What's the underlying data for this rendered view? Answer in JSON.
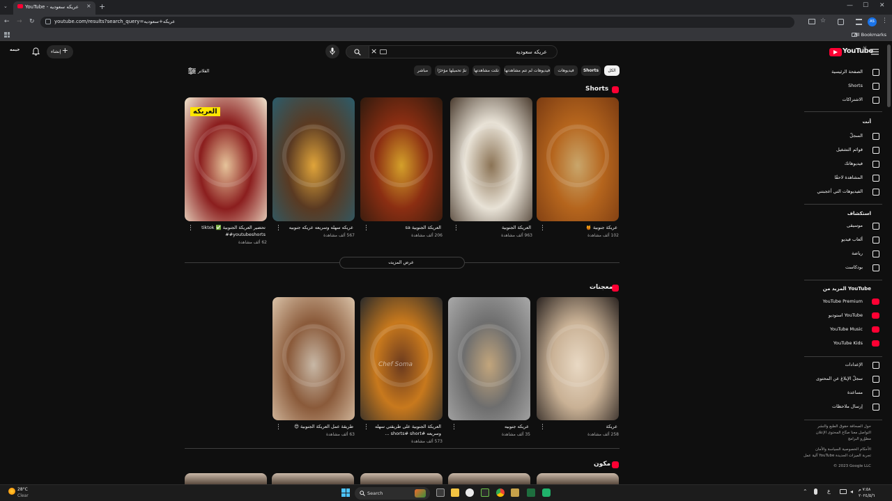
{
  "browser": {
    "tab_title": "YouTube - عريكه سعوديه",
    "tab_close": "×",
    "new_tab": "+",
    "url": "youtube.com/results?search_query=عريكه+سعوديه",
    "all_bookmarks": "All Bookmarks",
    "profile_initials": "AS",
    "window_controls": [
      "—",
      "☐",
      "✕"
    ]
  },
  "masthead": {
    "logo_text": "YouTube",
    "logo_region": "AE",
    "search_query": "عريكه سعوديه",
    "create_label": "إنشاء",
    "account_label": "خيمه"
  },
  "filters": {
    "label": "الفلاتر",
    "chips": [
      "الكل",
      "Shorts",
      "فيديوهات",
      "فيديوهات لم تتم مشاهدتها",
      "تمّت مشاهدتها",
      "تمّ تحميلها مؤخرًا",
      "مباشر"
    ]
  },
  "sidebar": {
    "main": [
      "الصفحة الرئيسية",
      "Shorts",
      "الاشتراكات"
    ],
    "you_header": "أنت",
    "you_items": [
      "السجلّ",
      "قوائم التشغيل",
      "فيديوهاتك",
      "المشاهدة لاحقًا",
      "الفيديوهات التي أعجبتني"
    ],
    "explore_header": "استكشاف",
    "explore_items": [
      "موسيقى",
      "ألعاب فيديو",
      "رياضة",
      "بودكاست"
    ],
    "more_header": "المزيد من YouTube",
    "more_items": [
      "YouTube Premium",
      "استوديو YouTube",
      "YouTube Music",
      "YouTube Kids"
    ],
    "settings_items": [
      "الإعدادات",
      "سجلّ الإبلاغ عن المحتوى",
      "مساعدة",
      "إرسال ملاحظات"
    ],
    "footer_1": "حول  الصحافة  حقوق الطبع والنشر",
    "footer_2": "التواصل معنا  صنّاع المحتوى  الإعلان",
    "footer_3": "مطوّرو البرامج",
    "footer_4": "الأحكام  الخصوصية  السياسة والأمان",
    "footer_5": "آلية عمل YouTube  تجربة الميزات الجديدة",
    "copyright": "© 2023 Google LLC"
  },
  "shorts_section": {
    "title": "Shorts",
    "show_more": "عرض المزيد",
    "items": [
      {
        "title": "عريكة جنوبية 🍯",
        "views": "102 ألف مشاهدة",
        "palette": [
          "#c9a66b",
          "#b5651d",
          "#7a3b12"
        ]
      },
      {
        "title": "العريكة الجنوبية",
        "views": "963 ألف مشاهدة",
        "palette": [
          "#8b7355",
          "#e8e2d6",
          "#4a3b2e"
        ]
      },
      {
        "title": "العريكة الجنوبية sa",
        "views": "206 ألف مشاهدة",
        "palette": [
          "#d4a02a",
          "#8b2e12",
          "#2f1a0e"
        ]
      },
      {
        "title": "عريكه سهله وسريعه عريكه جنوبيه",
        "views": "567 ألف مشاهدة",
        "palette": [
          "#e0a43a",
          "#5a3a22",
          "#2b5c6b"
        ]
      },
      {
        "title": "تحضير العريكة الجنوبية ✅ tiktok #youtubeshorts#",
        "views": "62 ألف مشاهدة",
        "palette": [
          "#e6c39a",
          "#8b1e1e",
          "#f1e6cf"
        ],
        "overlay": "العريكه"
      }
    ]
  },
  "dough_section": {
    "title": "معجنات",
    "items": [
      {
        "title": "عريكة",
        "views": "258 ألف مشاهدة",
        "palette": [
          "#e9d9c4",
          "#c9b195",
          "#2a2320"
        ]
      },
      {
        "title": "عريكه جنوبيه",
        "views": "35 ألف مشاهدة",
        "palette": [
          "#c2a57c",
          "#6e6e6e",
          "#a9a9a9"
        ]
      },
      {
        "title": "العريكة الجنوبية على طريقتي سهله وسريعه #shorts# short ...",
        "views": "573 ألف مشاهدة",
        "palette": [
          "#6b3a1e",
          "#c8791d",
          "#2a2a2a"
        ],
        "overlay": "Chef Soma"
      },
      {
        "title": "طريقة عمل العريكة الجنوبية 😍",
        "views": "63 ألف مشاهدة",
        "palette": [
          "#c8b8a6",
          "#8a5a3a",
          "#d9c2a8"
        ]
      }
    ]
  },
  "ingredients_section": {
    "title": "مكون"
  },
  "taskbar": {
    "weather_temp": "28°C",
    "weather_desc": "Clear",
    "search_placeholder": "Search",
    "clock_time": "٧:٥٨ م",
    "clock_date": "٢٠٢٤/٥/٦",
    "lang": "ع"
  },
  "colors": {
    "background": "#0f0f0f",
    "accent_red": "#ff0033",
    "chip_bg": "#272727"
  }
}
